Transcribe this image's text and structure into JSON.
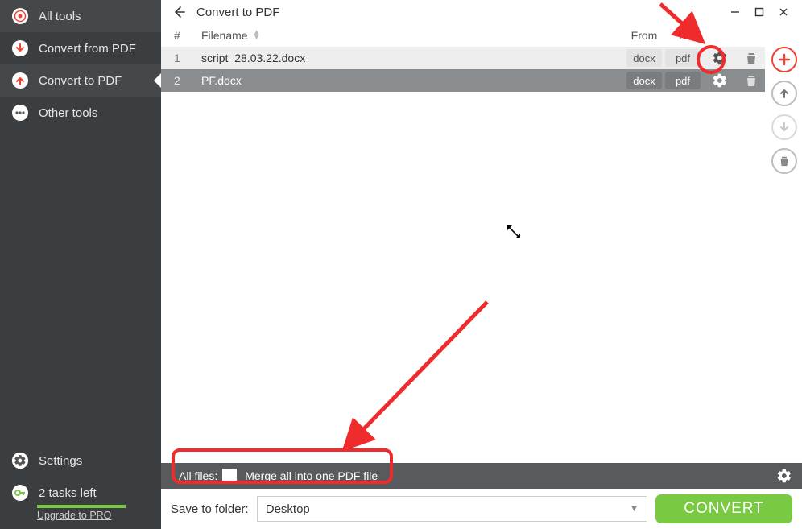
{
  "sidebar": {
    "items": [
      {
        "label": "All tools"
      },
      {
        "label": "Convert from PDF"
      },
      {
        "label": "Convert to PDF"
      },
      {
        "label": "Other tools"
      }
    ],
    "settings_label": "Settings",
    "tasks_label": "2 tasks left",
    "upgrade_label": "Upgrade to PRO"
  },
  "header": {
    "title": "Convert to PDF"
  },
  "table": {
    "col_num": "#",
    "col_name": "Filename",
    "col_from": "From",
    "col_to": "To",
    "rows": [
      {
        "num": "1",
        "name": "script_28.03.22.docx",
        "from": "docx",
        "to": "pdf"
      },
      {
        "num": "2",
        "name": "PF.docx",
        "from": "docx",
        "to": "pdf"
      }
    ]
  },
  "allfiles": {
    "label": "All files:",
    "merge_label": "Merge all into one PDF file"
  },
  "save": {
    "label": "Save to folder:",
    "value": "Desktop"
  },
  "convert_label": "CONVERT"
}
